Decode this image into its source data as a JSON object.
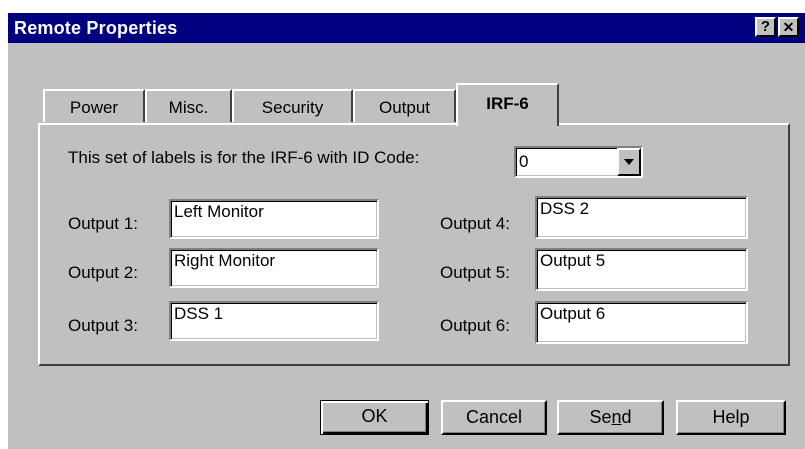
{
  "window": {
    "title": "Remote Properties",
    "help_button": "?",
    "close_button": "✕"
  },
  "tabs": [
    {
      "label": "Power",
      "active": false
    },
    {
      "label": "Misc.",
      "active": false
    },
    {
      "label": "Security",
      "active": false
    },
    {
      "label": "Output",
      "active": false
    },
    {
      "label": "IRF-6",
      "active": true
    }
  ],
  "panel": {
    "id_code_label": "This set of labels is for the IRF-6 with ID Code:",
    "id_code_value": "0",
    "outputs": [
      {
        "label": "Output 1:",
        "value": "Left Monitor"
      },
      {
        "label": "Output 2:",
        "value": "Right Monitor"
      },
      {
        "label": "Output 3:",
        "value": "DSS 1"
      },
      {
        "label": "Output 4:",
        "value": "DSS 2"
      },
      {
        "label": "Output 5:",
        "value": "Output 5"
      },
      {
        "label": "Output 6:",
        "value": "Output 6"
      }
    ]
  },
  "buttons": {
    "ok": "OK",
    "cancel": "Cancel",
    "send_pre": "Se",
    "send_u": "n",
    "send_post": "d",
    "help": "Help"
  },
  "colors": {
    "titlebar": "#000080",
    "face": "#c0c0c0"
  }
}
